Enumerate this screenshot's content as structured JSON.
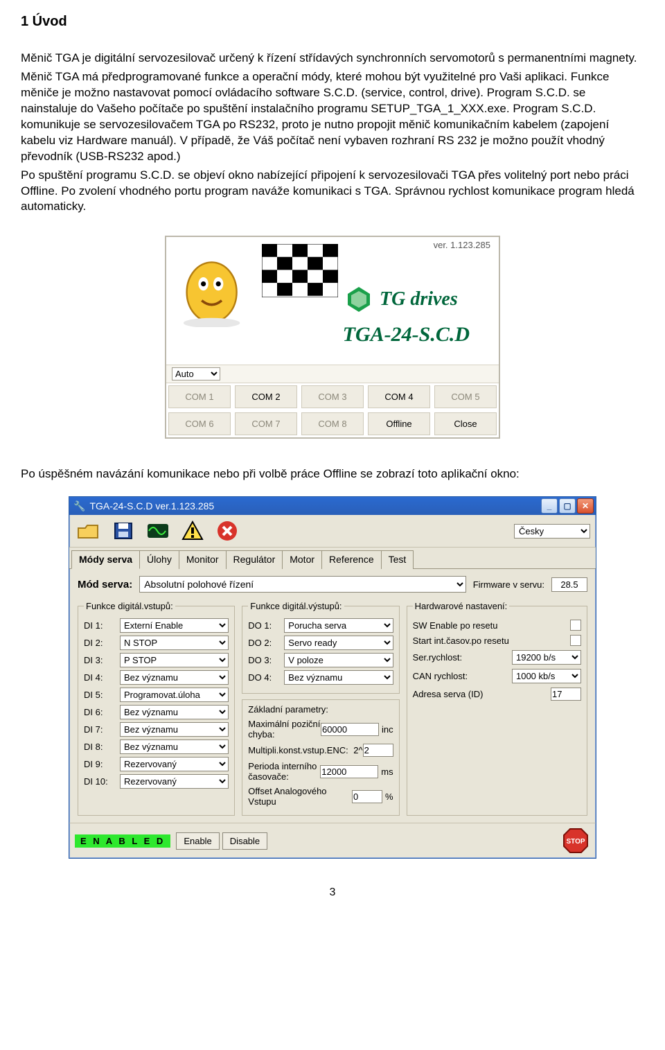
{
  "heading": "1   Úvod",
  "paragraphs": {
    "p1": "Měnič TGA je  digitální servozesilovač určený k řízení střídavých synchronních servomotorů s permanentními magnety.",
    "p2": "Měnič TGA má předprogramované funkce a operační módy, které mohou být využitelné pro Vaši aplikaci. Funkce měniče je možno nastavovat pomocí ovládacího software S.C.D. (service, control, drive). Program S.C.D. se nainstaluje do Vašeho počítače po spuštění instalačního programu SETUP_TGA_1_XXX.exe. Program S.C.D. komunikuje se servozesilovačem TGA po RS232, proto je nutno propojit měnič komunikačním kabelem (zapojení kabelu viz Hardware manuál). V případě, že Váš počítač není vybaven rozhraní RS 232 je možno použít vhodný převodník (USB-RS232 apod.)",
    "p3": "Po spuštění programu S.C.D. se objeví okno nabízející připojení k servozesilovači TGA přes volitelný port nebo práci Offline. Po zvolení vhodného portu program naváže komunikaci s TGA. Správnou rychlost komunikace program hledá automaticky.",
    "p4": "Po úspěšném navázání komunikace nebo při volbě práce Offline se zobrazí  toto aplikační okno:"
  },
  "splash": {
    "version": "ver. 1.123.285",
    "brand": "TG drives",
    "product": "TGA-24-S.C.D",
    "auto": "Auto",
    "buttons": [
      "COM 1",
      "COM 2",
      "COM 3",
      "COM 4",
      "COM 5",
      "COM 6",
      "COM 7",
      "COM 8",
      "Offline",
      "Close"
    ],
    "buttons_active": [
      false,
      true,
      false,
      true,
      false,
      false,
      false,
      false,
      true,
      true
    ]
  },
  "app": {
    "title": "TGA-24-S.C.D  ver.1.123.285",
    "lang": "Česky",
    "tabs": [
      "Módy serva",
      "Úlohy",
      "Monitor",
      "Regulátor",
      "Motor",
      "Reference",
      "Test"
    ],
    "active_tab": 0,
    "mode_label": "Mód serva:",
    "mode_value": "Absolutní polohové řízení",
    "fw_label": "Firmware v servu:",
    "fw_value": "28.5",
    "di_legend": "Funkce digitál.vstupů:",
    "do_legend": "Funkce digitál.výstupů:",
    "hw_legend": "Hardwarové nastavení:",
    "bp_legend": "Základní parametry:",
    "di": [
      {
        "label": "DI 1:",
        "value": "Externí Enable"
      },
      {
        "label": "DI 2:",
        "value": "N STOP"
      },
      {
        "label": "DI 3:",
        "value": "P STOP"
      },
      {
        "label": "DI 4:",
        "value": "Bez významu"
      },
      {
        "label": "DI 5:",
        "value": "Programovat.úloha"
      },
      {
        "label": "DI 6:",
        "value": "Bez významu"
      },
      {
        "label": "DI 7:",
        "value": "Bez významu"
      },
      {
        "label": "DI 8:",
        "value": "Bez významu"
      },
      {
        "label": "DI 9:",
        "value": "Rezervovaný"
      },
      {
        "label": "DI 10:",
        "value": "Rezervovaný"
      }
    ],
    "do": [
      {
        "label": "DO 1:",
        "value": "Porucha serva"
      },
      {
        "label": "DO 2:",
        "value": "Servo ready"
      },
      {
        "label": "DO 3:",
        "value": "V poloze"
      },
      {
        "label": "DO 4:",
        "value": "Bez významu"
      }
    ],
    "hw": {
      "sw_enable": "SW Enable po resetu",
      "start_int": "Start int.časov.po resetu",
      "ser_rate_label": "Ser.rychlost:",
      "ser_rate": "19200 b/s",
      "can_rate_label": "CAN rychlost:",
      "can_rate": "1000 kb/s",
      "addr_label": "Adresa serva (ID)",
      "addr": "17"
    },
    "bp": {
      "max_err_label": "Maximální poziční chyba:",
      "max_err": "60000",
      "max_err_unit": "inc",
      "mult_label": "Multipli.konst.vstup.ENC:",
      "mult_prefix": "2^",
      "mult": "2",
      "period_label": "Perioda interního časovače:",
      "period": "12000",
      "period_unit": "ms",
      "offset_label": "Offset Analogového Vstupu",
      "offset": "0",
      "offset_unit": "%"
    },
    "footer": {
      "enabled": "E N A B L E D",
      "enable_btn": "Enable",
      "disable_btn": "Disable"
    }
  },
  "page_number": "3"
}
